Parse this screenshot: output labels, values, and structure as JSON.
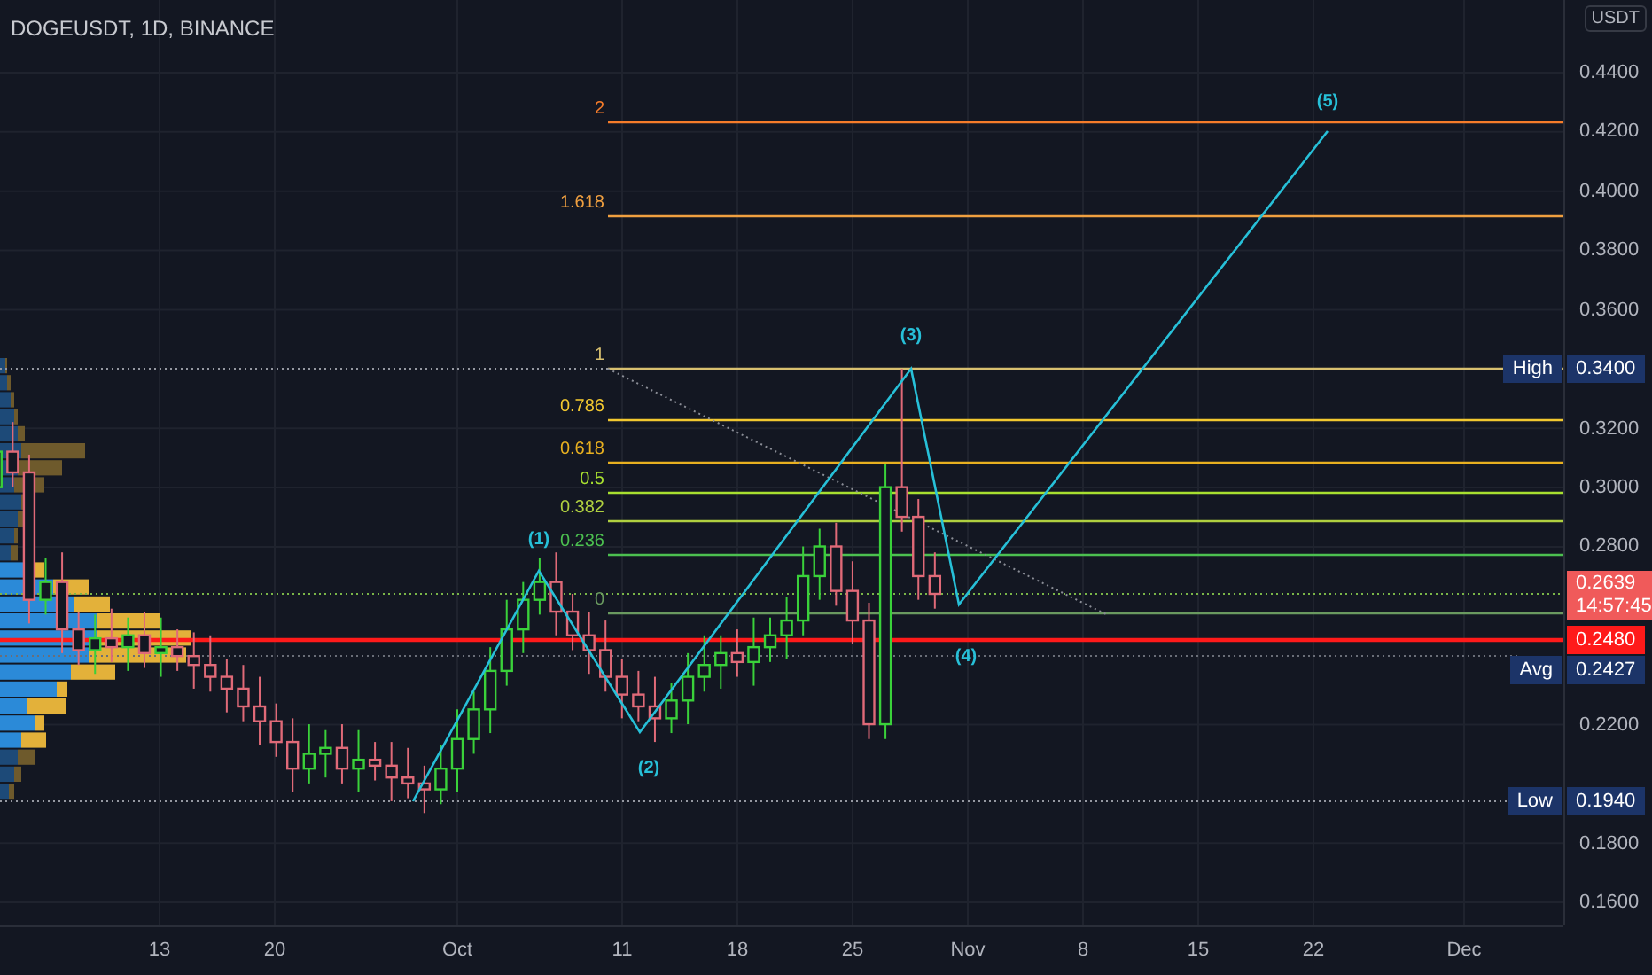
{
  "header": {
    "title": "DOGEUSDT, 1D, BINANCE"
  },
  "price_axis": {
    "currency": "USDT",
    "ticks": [
      "0.4400",
      "0.4200",
      "0.4000",
      "0.3800",
      "0.3600",
      "0.3200",
      "0.3000",
      "0.2800",
      "0.2200",
      "0.1800",
      "0.1600"
    ]
  },
  "time_axis": {
    "ticks": [
      "13",
      "20",
      "Oct",
      "11",
      "18",
      "25",
      "Nov",
      "8",
      "15",
      "22",
      "Dec"
    ]
  },
  "price_markers": [
    {
      "kind": "tag",
      "label": "High",
      "value": "0.3400"
    },
    {
      "kind": "last",
      "value": "0.2639",
      "countdown": "14:57:45"
    },
    {
      "kind": "line",
      "value": "0.2480"
    },
    {
      "kind": "tag",
      "label": "Avg",
      "value": "0.2427"
    },
    {
      "kind": "tag",
      "label": "Low",
      "value": "0.1940"
    }
  ],
  "fib_levels": [
    {
      "label": "2",
      "color": "#f57c2a"
    },
    {
      "label": "1.618",
      "color": "#f0a040"
    },
    {
      "label": "1",
      "color": "#d8c070"
    },
    {
      "label": "0.786",
      "color": "#f2c830"
    },
    {
      "label": "0.618",
      "color": "#e8b020"
    },
    {
      "label": "0.5",
      "color": "#a8e030"
    },
    {
      "label": "0.382",
      "color": "#b0d040"
    },
    {
      "label": "0.236",
      "color": "#4cc050"
    },
    {
      "label": "0",
      "color": "#6a9a60"
    }
  ],
  "wave_labels": [
    "(1)",
    "(2)",
    "(3)",
    "(4)",
    "(5)"
  ]
}
